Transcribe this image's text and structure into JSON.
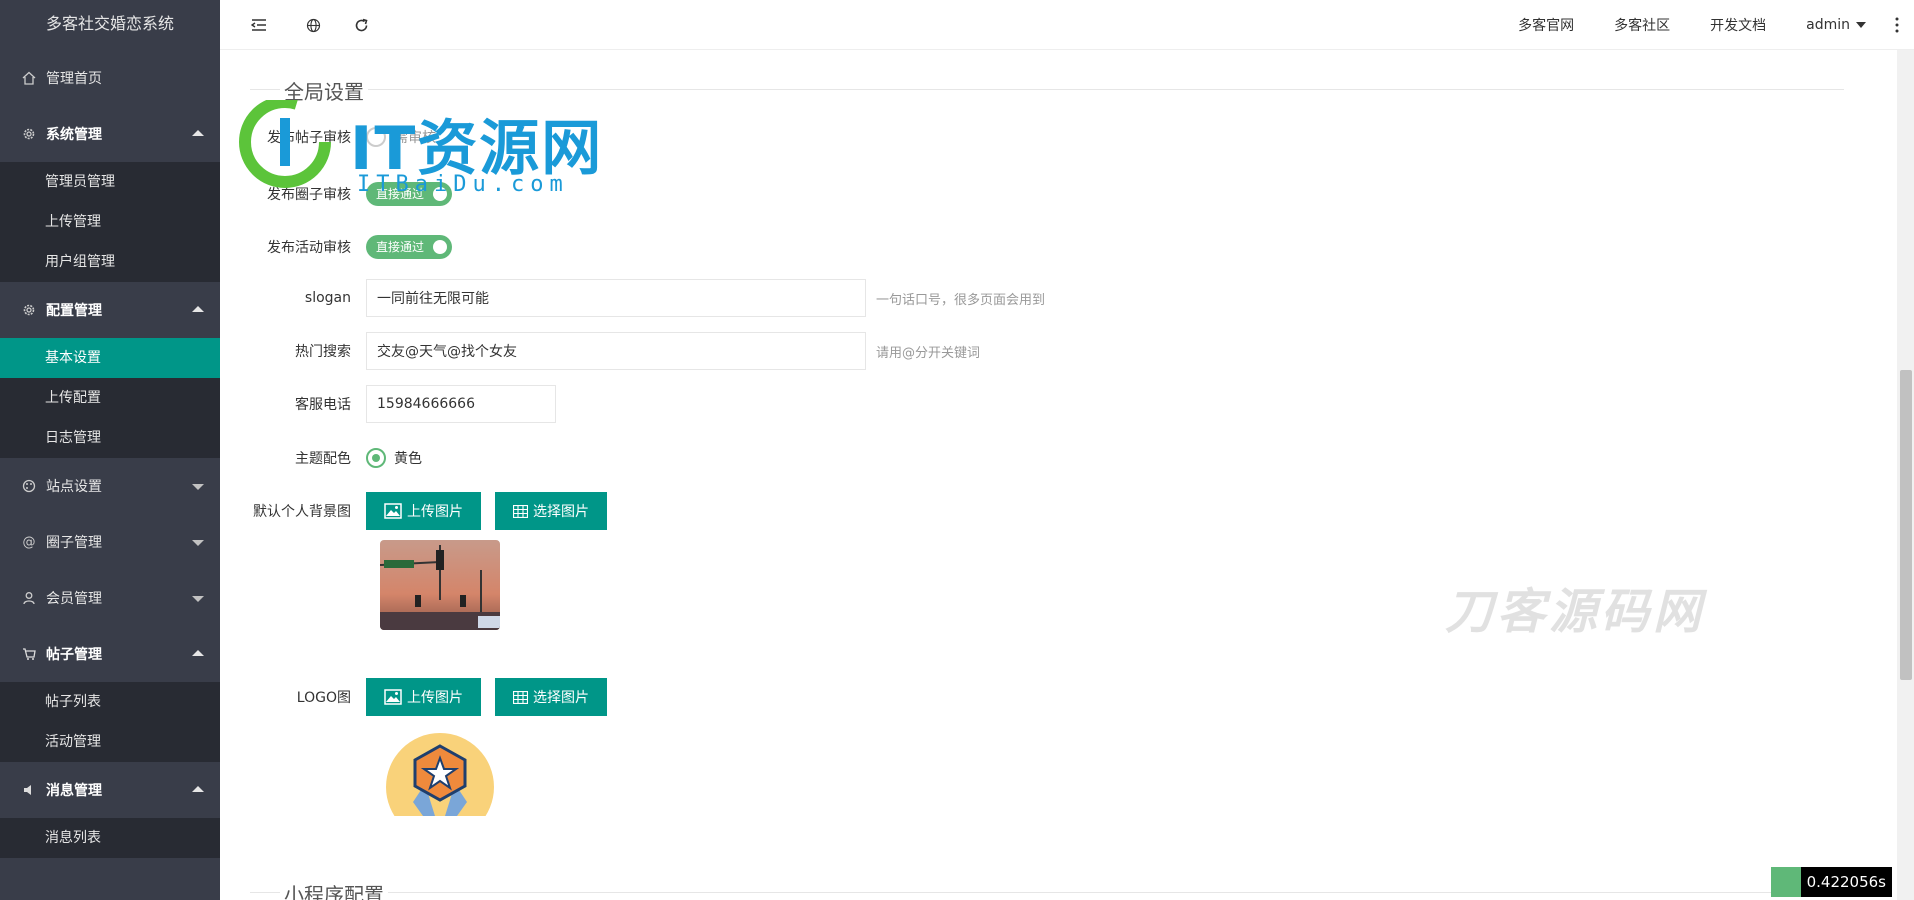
{
  "app": {
    "title": "多客社交婚恋系统"
  },
  "sidebar": {
    "home": "管理首页",
    "system": {
      "label": "系统管理",
      "items": [
        "管理员管理",
        "上传管理",
        "用户组管理"
      ]
    },
    "config": {
      "label": "配置管理",
      "items": [
        "基本设置",
        "上传配置",
        "日志管理"
      ],
      "active": "基本设置"
    },
    "site": "站点设置",
    "circle": "圈子管理",
    "member": "会员管理",
    "posts": {
      "label": "帖子管理",
      "items": [
        "帖子列表",
        "活动管理"
      ]
    },
    "messages": {
      "label": "消息管理",
      "items": [
        "消息列表"
      ]
    }
  },
  "header": {
    "links": [
      "多客官网",
      "多客社区",
      "开发文档"
    ],
    "user": "admin"
  },
  "section": {
    "global_title": "全局设置",
    "miniapp_title": "小程序配置"
  },
  "form": {
    "post_review": {
      "label": "发布帖子审核",
      "value": "需审核"
    },
    "circle_review": {
      "label": "发布圈子审核",
      "value": "直接通过"
    },
    "activity_review": {
      "label": "发布活动审核",
      "value": "直接通过"
    },
    "slogan": {
      "label": "slogan",
      "value": "一同前往无限可能",
      "hint": "一句话口号，很多页面会用到"
    },
    "hot_search": {
      "label": "热门搜索",
      "value": "交友@天气@找个女友",
      "hint": "请用@分开关键词"
    },
    "phone": {
      "label": "客服电话",
      "value": "15984666666"
    },
    "theme": {
      "label": "主题配色",
      "value": "黄色"
    },
    "bg_image": {
      "label": "默认个人背景图",
      "upload": "上传图片",
      "select": "选择图片"
    },
    "logo": {
      "label": "LOGO图",
      "upload": "上传图片",
      "select": "选择图片"
    }
  },
  "watermark": {
    "brand": "IT资源网",
    "domain": "ITBaiDu.com",
    "brand2": "刀客源码网"
  },
  "debug": {
    "time": "0.422056s"
  },
  "colors": {
    "primary": "#009688",
    "switch": "#5FB878",
    "sidebar": "#393D49",
    "sidebar_sub": "#282B33"
  }
}
